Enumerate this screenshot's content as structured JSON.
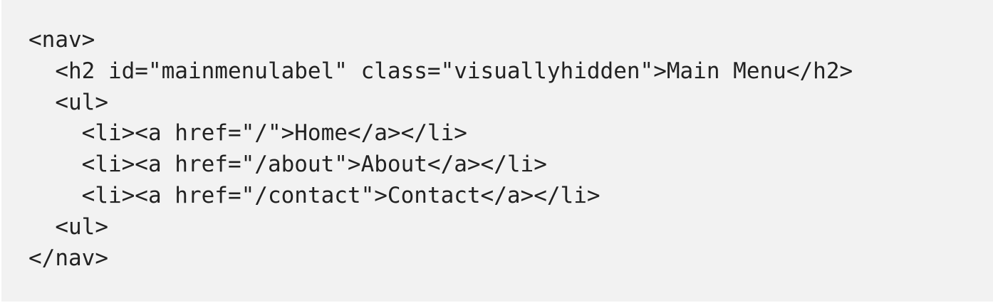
{
  "code": {
    "lines": [
      "<nav>",
      "  <h2 id=\"mainmenulabel\" class=\"visuallyhidden\">Main Menu</h2>",
      "  <ul>",
      "    <li><a href=\"/\">Home</a></li>",
      "    <li><a href=\"/about\">About</a></li>",
      "    <li><a href=\"/contact\">Contact</a></li>",
      "  <ul>",
      "</nav>"
    ]
  },
  "colors": {
    "background": "#f2f2f2",
    "text": "#222222"
  }
}
